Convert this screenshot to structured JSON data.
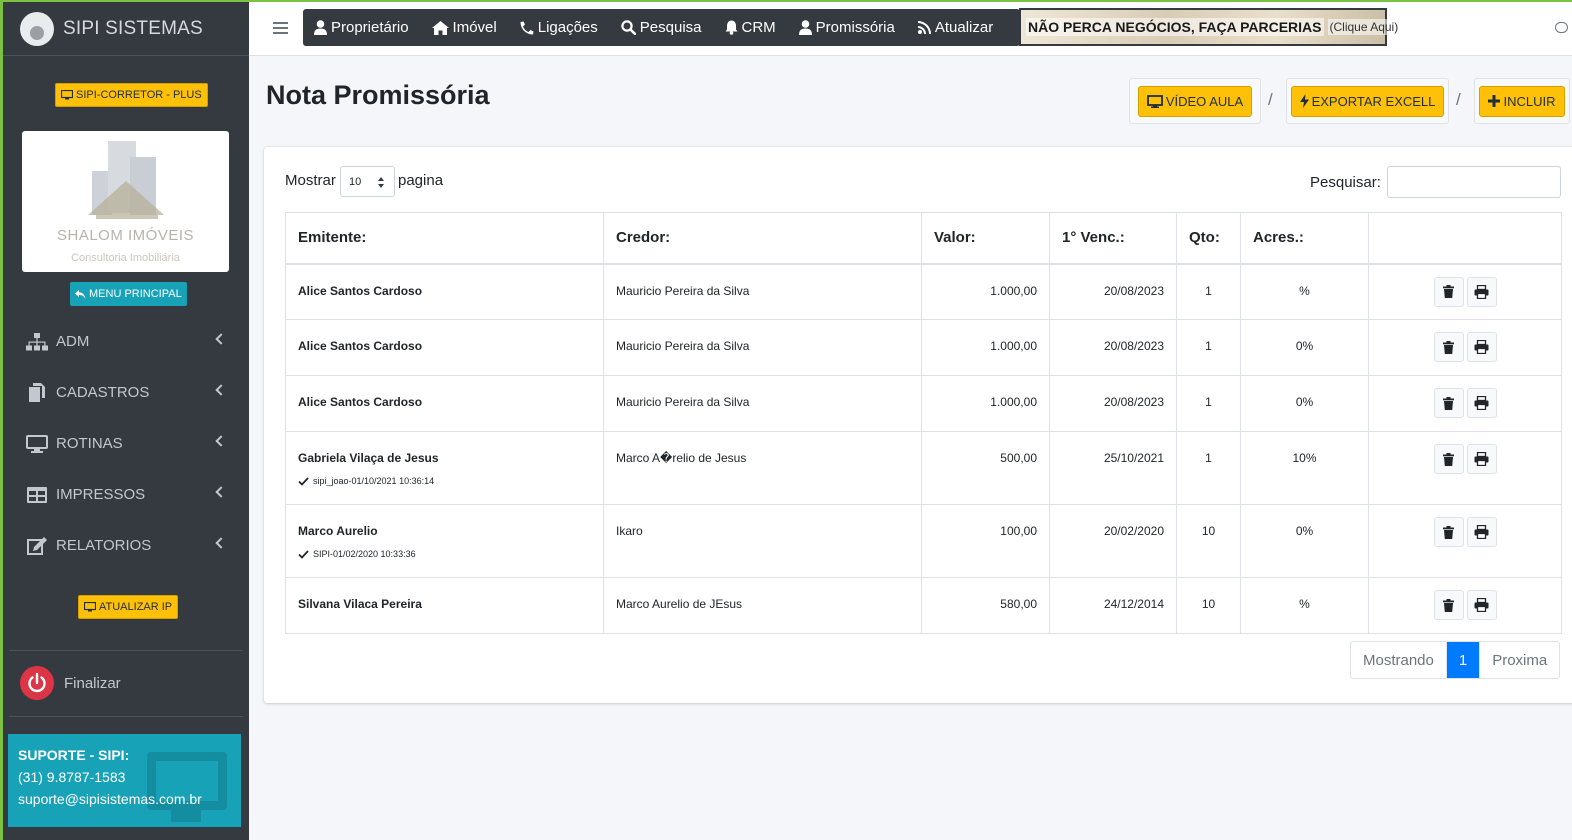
{
  "sidebar": {
    "brand": "SIPI SISTEMAS",
    "plan_label": "SIPI-CORRETOR - PLUS",
    "logo_title": "SHALOM IMÓVEIS",
    "logo_subtitle": "Consultoria Imobiliária",
    "menu_principal": "MENU PRINCIPAL",
    "items": [
      {
        "label": "ADM",
        "icon": "sitemap-icon"
      },
      {
        "label": "CADASTROS",
        "icon": "copy-icon"
      },
      {
        "label": "ROTINAS",
        "icon": "desktop-icon"
      },
      {
        "label": "IMPRESSOS",
        "icon": "table-icon"
      },
      {
        "label": "RELATORIOS",
        "icon": "edit-icon"
      }
    ],
    "atualizar_ip": "ATUALIZAR IP",
    "logout": "Finalizar",
    "support": {
      "title": "SUPORTE - SIPI:",
      "phone": "(31) 9.8787-1583",
      "email": "suporte@sipisistemas.com.br"
    }
  },
  "topnav": {
    "items": [
      "Proprietário",
      "Imóvel",
      "Ligações",
      "Pesquisa",
      "CRM",
      "Promissória",
      "Atualizar"
    ],
    "banner_main": "NÃO PERCA NEGÓCIOS, FAÇA PARCERIAS",
    "banner_sub": "(Clique Aqui)"
  },
  "page": {
    "title": "Nota Promissória",
    "actions": {
      "video": "VÍDEO AULA",
      "export": "EXPORTAR EXCELL",
      "include": "INCLUIR"
    },
    "separator": "/"
  },
  "table_controls": {
    "show_label": "Mostrar",
    "page_size": "10",
    "page_label": "pagina",
    "search_label": "Pesquisar:"
  },
  "table": {
    "headers": [
      "Emitente:",
      "Credor:",
      "Valor:",
      "1° Venc.:",
      "Qto:",
      "Acres.:",
      ""
    ],
    "rows": [
      {
        "emitente": "Alice Santos Cardoso",
        "meta": "",
        "credor": "Mauricio Pereira da Silva",
        "valor": "1.000,00",
        "venc": "20/08/2023",
        "qto": "1",
        "acres": "%"
      },
      {
        "emitente": "Alice Santos Cardoso",
        "meta": "",
        "credor": "Mauricio Pereira da Silva",
        "valor": "1.000,00",
        "venc": "20/08/2023",
        "qto": "1",
        "acres": "0%"
      },
      {
        "emitente": "Alice Santos Cardoso",
        "meta": "",
        "credor": "Mauricio Pereira da Silva",
        "valor": "1.000,00",
        "venc": "20/08/2023",
        "qto": "1",
        "acres": "0%"
      },
      {
        "emitente": "Gabriela Vilaça de Jesus",
        "meta": "sipi_joao-01/10/2021 10:36:14",
        "credor": "Marco A�relio de Jesus",
        "valor": "500,00",
        "venc": "25/10/2021",
        "qto": "1",
        "acres": "10%"
      },
      {
        "emitente": "Marco Aurelio",
        "meta": "SIPI-01/02/2020 10:33:36",
        "credor": "Ikaro",
        "valor": "100,00",
        "venc": "20/02/2020",
        "qto": "10",
        "acres": "0%"
      },
      {
        "emitente": "Silvana Vilaca Pereira",
        "meta": "",
        "credor": "Marco Aurelio de JEsus",
        "valor": "580,00",
        "venc": "24/12/2014",
        "qto": "10",
        "acres": "%"
      }
    ]
  },
  "pagination": {
    "showing": "Mostrando",
    "current": "1",
    "next": "Proxima"
  },
  "colors": {
    "accent_yellow": "#ffc107",
    "accent_cyan": "#17a2b8",
    "sidebar_bg": "#343a40",
    "primary": "#007bff",
    "danger": "#dc3545"
  }
}
